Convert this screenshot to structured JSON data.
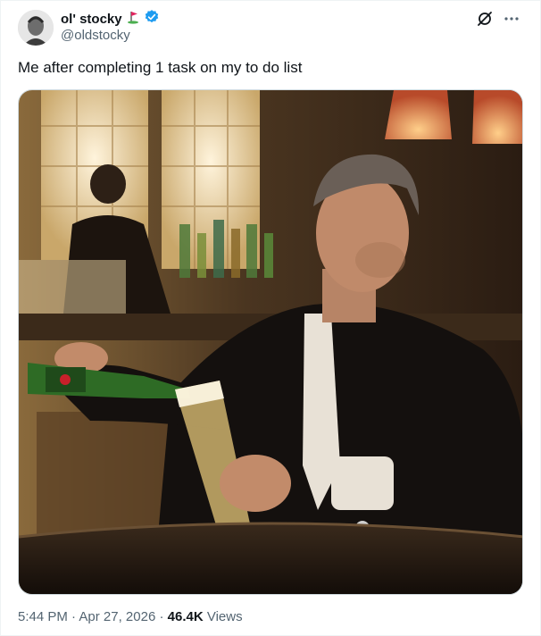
{
  "author": {
    "display_name": "ol' stocky",
    "handle": "@oldstocky",
    "verified": true,
    "name_emoji": "golf-flag-icon"
  },
  "tweet": {
    "text": "Me after completing 1 task on my to do list"
  },
  "meta": {
    "time": "5:44 PM",
    "separator1": " · ",
    "date": "Apr 27, 2026",
    "separator2": " · ",
    "views_count": "46.4K",
    "views_label": " Views"
  },
  "colors": {
    "verified_badge": "#1d9bf0",
    "secondary_text": "#536471",
    "primary_text": "#0f1419"
  },
  "icons": [
    "grok-icon",
    "more-icon",
    "verified-badge-icon",
    "golf-flag-icon"
  ]
}
